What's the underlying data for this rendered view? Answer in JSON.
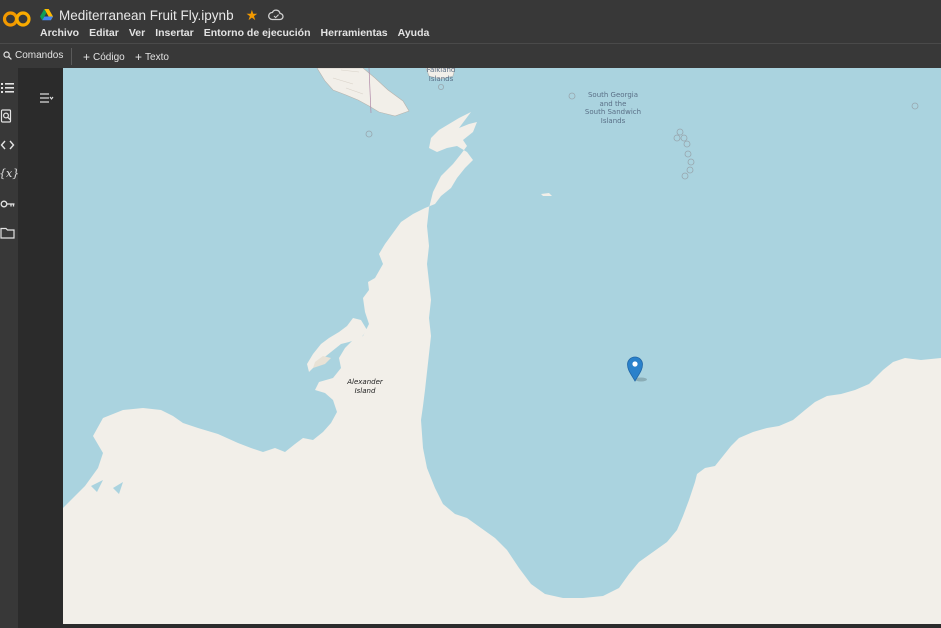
{
  "app": {
    "title": "Mediterranean Fruit Fly.ipynb",
    "logo_icon": "colab-logo-icon",
    "drive_icon": "google-drive-icon",
    "star_icon": "star-icon",
    "cloud_icon": "cloud-saved-icon",
    "accent": "#f29900"
  },
  "menu": [
    "Archivo",
    "Editar",
    "Ver",
    "Insertar",
    "Entorno de ejecución",
    "Herramientas",
    "Ayuda"
  ],
  "toolbar": {
    "commands_label": "Comandos",
    "add_code_label": "Código",
    "add_text_label": "Texto"
  },
  "sidebar": {
    "items": [
      "table-of-contents-icon",
      "find-icon",
      "code-snippets-icon",
      "variables-icon",
      "secrets-key-icon",
      "files-folder-icon"
    ]
  },
  "map": {
    "labels": {
      "falkland": "Falkland\nIslands",
      "south_georgia": "South Georgia\nand the\nSouth Sandwich\nIslands",
      "alexander": "Alexander\nIsland"
    },
    "water_color": "#aad3df",
    "land_color": "#f2efe9",
    "marker_color": "#2a81cb"
  }
}
